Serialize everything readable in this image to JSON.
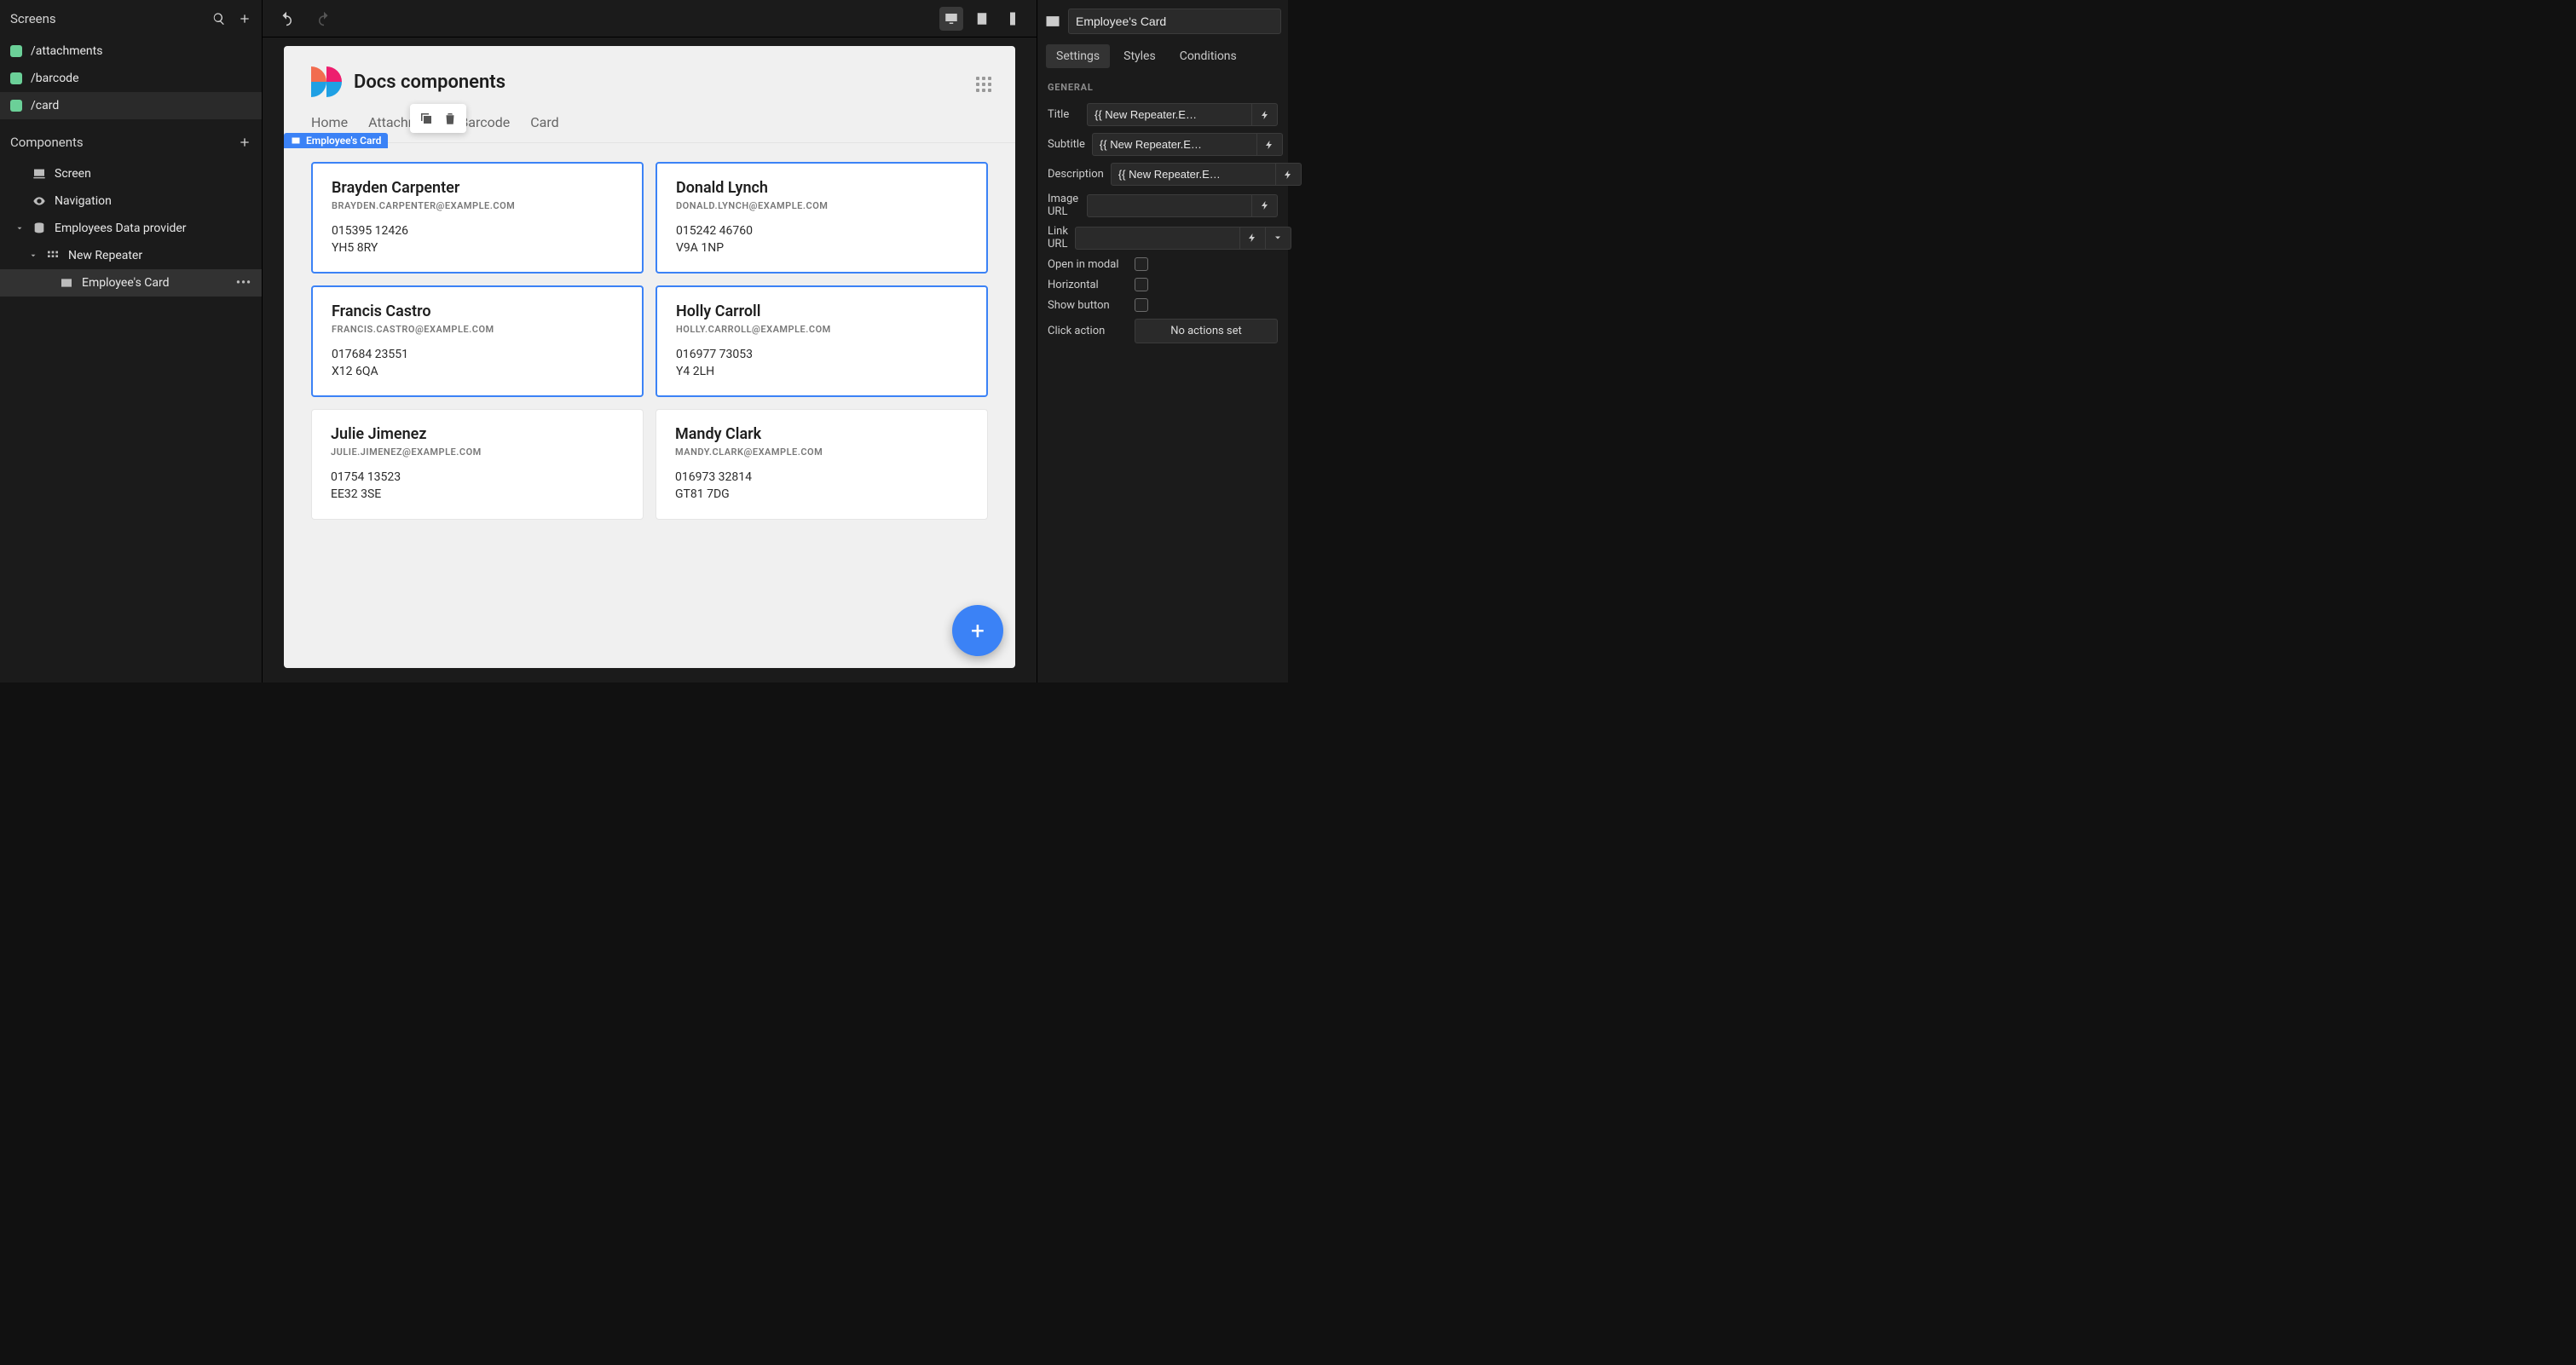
{
  "sidebar": {
    "screens_header": "Screens",
    "screens": [
      {
        "label": "/attachments"
      },
      {
        "label": "/barcode"
      },
      {
        "label": "/card"
      }
    ],
    "components_header": "Components",
    "tree": {
      "screen": "Screen",
      "navigation": "Navigation",
      "provider": "Employees Data provider",
      "repeater": "New Repeater",
      "card": "Employee's Card"
    }
  },
  "canvas": {
    "app_title": "Docs components",
    "nav": [
      "Home",
      "Attachment",
      "Barcode",
      "Card"
    ],
    "badge": "Employee's Card",
    "employees": [
      {
        "name": "Brayden Carpenter",
        "email": "BRAYDEN.CARPENTER@EXAMPLE.COM",
        "phone": "015395 12426",
        "postcode": "YH5 8RY",
        "selected": true
      },
      {
        "name": "Donald Lynch",
        "email": "DONALD.LYNCH@EXAMPLE.COM",
        "phone": "015242 46760",
        "postcode": "V9A 1NP",
        "selected": true
      },
      {
        "name": "Francis Castro",
        "email": "FRANCIS.CASTRO@EXAMPLE.COM",
        "phone": "017684 23551",
        "postcode": "X12 6QA",
        "selected": true
      },
      {
        "name": "Holly Carroll",
        "email": "HOLLY.CARROLL@EXAMPLE.COM",
        "phone": "016977 73053",
        "postcode": "Y4 2LH",
        "selected": true
      },
      {
        "name": "Julie Jimenez",
        "email": "JULIE.JIMENEZ@EXAMPLE.COM",
        "phone": "01754 13523",
        "postcode": "EE32 3SE",
        "selected": false
      },
      {
        "name": "Mandy Clark",
        "email": "MANDY.CLARK@EXAMPLE.COM",
        "phone": "016973 32814",
        "postcode": "GT81 7DG",
        "selected": false
      }
    ]
  },
  "right": {
    "component_name": "Employee's Card",
    "tabs": [
      "Settings",
      "Styles",
      "Conditions"
    ],
    "section": "GENERAL",
    "fields": {
      "title_label": "Title",
      "title_value": "{{ New Repeater.E…",
      "subtitle_label": "Subtitle",
      "subtitle_value": "{{ New Repeater.E…",
      "description_label": "Description",
      "description_value": "{{ New Repeater.E…",
      "imageurl_label": "Image URL",
      "imageurl_value": "",
      "linkurl_label": "Link URL",
      "linkurl_value": "",
      "openmodal_label": "Open in modal",
      "horizontal_label": "Horizontal",
      "showbutton_label": "Show button",
      "clickaction_label": "Click action",
      "clickaction_value": "No actions set"
    }
  }
}
